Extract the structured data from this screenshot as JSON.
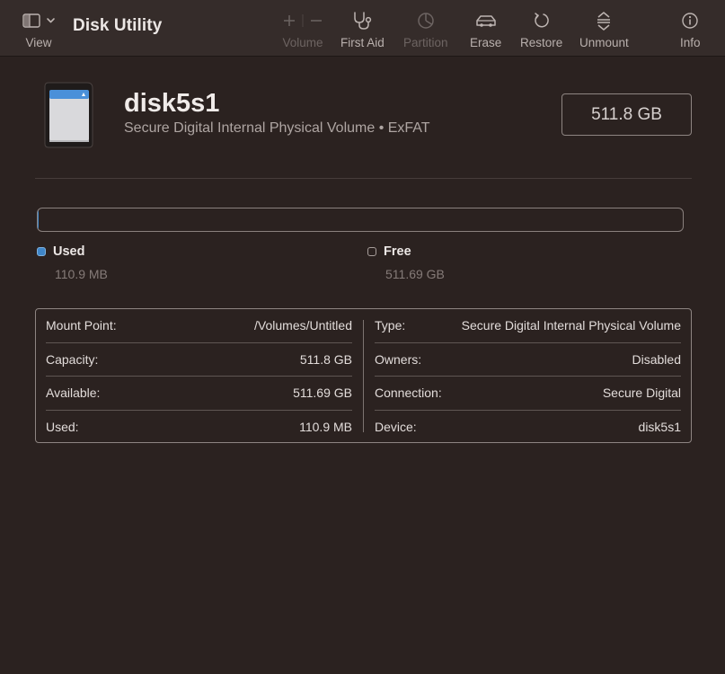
{
  "toolbar": {
    "view_label": "View",
    "app_title": "Disk Utility",
    "volume_label": "Volume",
    "first_aid_label": "First Aid",
    "partition_label": "Partition",
    "erase_label": "Erase",
    "restore_label": "Restore",
    "unmount_label": "Unmount",
    "info_label": "Info"
  },
  "disk": {
    "name": "disk5s1",
    "subtitle": "Secure Digital Internal Physical Volume • ExFAT",
    "capacity_badge": "511.8 GB",
    "icon": "sd-card-icon"
  },
  "usage": {
    "used_fraction": 0.0002,
    "used_label": "Used",
    "used_value": "110.9 MB",
    "free_label": "Free",
    "free_value": "511.69 GB",
    "used_color": "#3f86c8"
  },
  "info": {
    "left": [
      {
        "key": "Mount Point:",
        "value": "/Volumes/Untitled"
      },
      {
        "key": "Capacity:",
        "value": "511.8 GB"
      },
      {
        "key": "Available:",
        "value": "511.69 GB"
      },
      {
        "key": "Used:",
        "value": "110.9 MB"
      }
    ],
    "right": [
      {
        "key": "Type:",
        "value": "Secure Digital Internal Physical Volume"
      },
      {
        "key": "Owners:",
        "value": "Disabled"
      },
      {
        "key": "Connection:",
        "value": "Secure Digital"
      },
      {
        "key": "Device:",
        "value": "disk5s1"
      }
    ]
  }
}
